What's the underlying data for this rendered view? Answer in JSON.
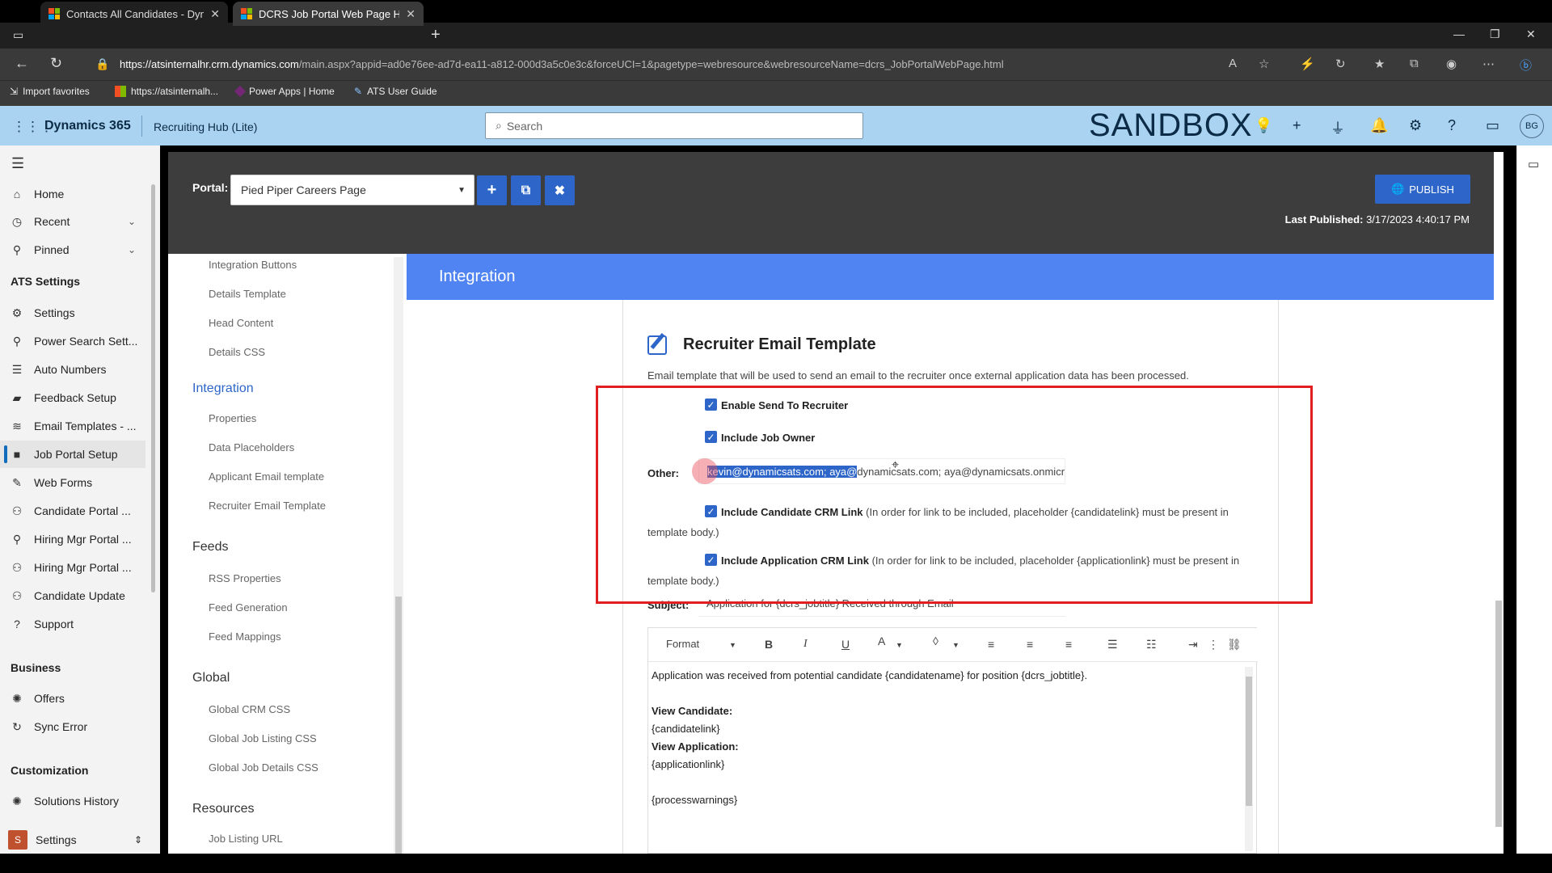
{
  "browser": {
    "tabs": [
      {
        "label": "Contacts All Candidates - Dynam"
      },
      {
        "label": "DCRS Job Portal Web Page HTML"
      }
    ],
    "url_host": "https://atsinternalhr.crm.dynamics.com",
    "url_path": "/main.aspx?appid=ad0e76ee-ad7d-ea11-a812-000d3a5c0e3c&forceUCI=1&pagetype=webresource&webresourceName=dcrs_JobPortalWebPage.html",
    "favorites": [
      {
        "label": "Import favorites"
      },
      {
        "label": "https://atsinternalh..."
      },
      {
        "label": "Power Apps | Home"
      },
      {
        "label": "ATS User Guide"
      }
    ]
  },
  "header": {
    "app_name": "Dynamics 365",
    "hub_name": "Recruiting Hub (Lite)",
    "search_placeholder": "Search",
    "environment": "SANDBOX",
    "avatar": "BG"
  },
  "leftnav": {
    "items_top": [
      {
        "label": "Home",
        "icon": "home-icon"
      },
      {
        "label": "Recent",
        "icon": "clock-icon"
      },
      {
        "label": "Pinned",
        "icon": "pin-icon"
      }
    ],
    "sections": [
      {
        "title": "ATS Settings",
        "items": [
          {
            "label": "Settings"
          },
          {
            "label": "Power Search Sett..."
          },
          {
            "label": "Auto Numbers"
          },
          {
            "label": "Feedback Setup"
          },
          {
            "label": "Email Templates - ..."
          },
          {
            "label": "Job Portal Setup"
          },
          {
            "label": "Web Forms"
          },
          {
            "label": "Candidate Portal ..."
          },
          {
            "label": "Hiring Mgr Portal ..."
          },
          {
            "label": "Hiring Mgr Portal ..."
          },
          {
            "label": "Candidate Update"
          },
          {
            "label": "Support"
          }
        ]
      },
      {
        "title": "Business",
        "items": [
          {
            "label": "Offers"
          },
          {
            "label": "Sync Error"
          }
        ]
      },
      {
        "title": "Customization",
        "items": [
          {
            "label": "Solutions History"
          }
        ]
      }
    ],
    "area_switcher": {
      "badge": "S",
      "label": "Settings"
    }
  },
  "portal": {
    "label": "Portal:",
    "selected": "Pied Piper Careers Page",
    "publish_label": "PUBLISH",
    "last_published_label": "Last Published:",
    "last_published_value": "3/17/2023 4:40:17 PM"
  },
  "subnav": {
    "items": [
      {
        "label": "Integration Buttons",
        "level": 2
      },
      {
        "label": "Details Template",
        "level": 2
      },
      {
        "label": "Head Content",
        "level": 2
      },
      {
        "label": "Details CSS",
        "level": 2
      },
      {
        "label": "Integration",
        "level": 1
      },
      {
        "label": "Properties",
        "level": 2
      },
      {
        "label": "Data Placeholders",
        "level": 2
      },
      {
        "label": "Applicant Email template",
        "level": 2
      },
      {
        "label": "Recruiter Email Template",
        "level": 2
      },
      {
        "label": "Feeds",
        "level": 1
      },
      {
        "label": "RSS Properties",
        "level": 2
      },
      {
        "label": "Feed Generation",
        "level": 2
      },
      {
        "label": "Feed Mappings",
        "level": 2
      },
      {
        "label": "Global",
        "level": 1
      },
      {
        "label": "Global CRM CSS",
        "level": 2
      },
      {
        "label": "Global Job Listing CSS",
        "level": 2
      },
      {
        "label": "Global Job Details CSS",
        "level": 2
      },
      {
        "label": "Resources",
        "level": 1
      },
      {
        "label": "Job Listing URL",
        "level": 2
      }
    ]
  },
  "main": {
    "section_title": "Integration",
    "card_title": "Recruiter Email Template",
    "card_desc": "Email template that will be used to send an email to the recruiter once external application data has been processed.",
    "enable_send": "Enable Send To Recruiter",
    "include_owner": "Include Job Owner",
    "other_label": "Other:",
    "other_selected": "kevin@dynamicsats.com; aya@",
    "other_rest": "dynamicsats.com; aya@dynamicsats.onmicrosoft.com",
    "cand_link_label": "Include Candidate CRM Link",
    "cand_link_note": " (In order for link to be included, placeholder {candidatelink} must be present in template body.)",
    "app_link_label": "Include Application CRM Link",
    "app_link_note": " (In order for link to be included, placeholder {applicationlink} must be present in template body.)",
    "subject_label": "Subject:",
    "subject_value": "Application for {dcrs_jobtitle} Received through Email",
    "editor": {
      "format_label": "Format",
      "body_line1": "Application was received from potential candidate {candidatename} for position {dcrs_jobtitle}.",
      "view_candidate": "View Candidate:",
      "candidate_link": "{candidatelink}",
      "view_application": "View Application:",
      "application_link": "{applicationlink}",
      "trailing": "{processwarnings}"
    }
  }
}
